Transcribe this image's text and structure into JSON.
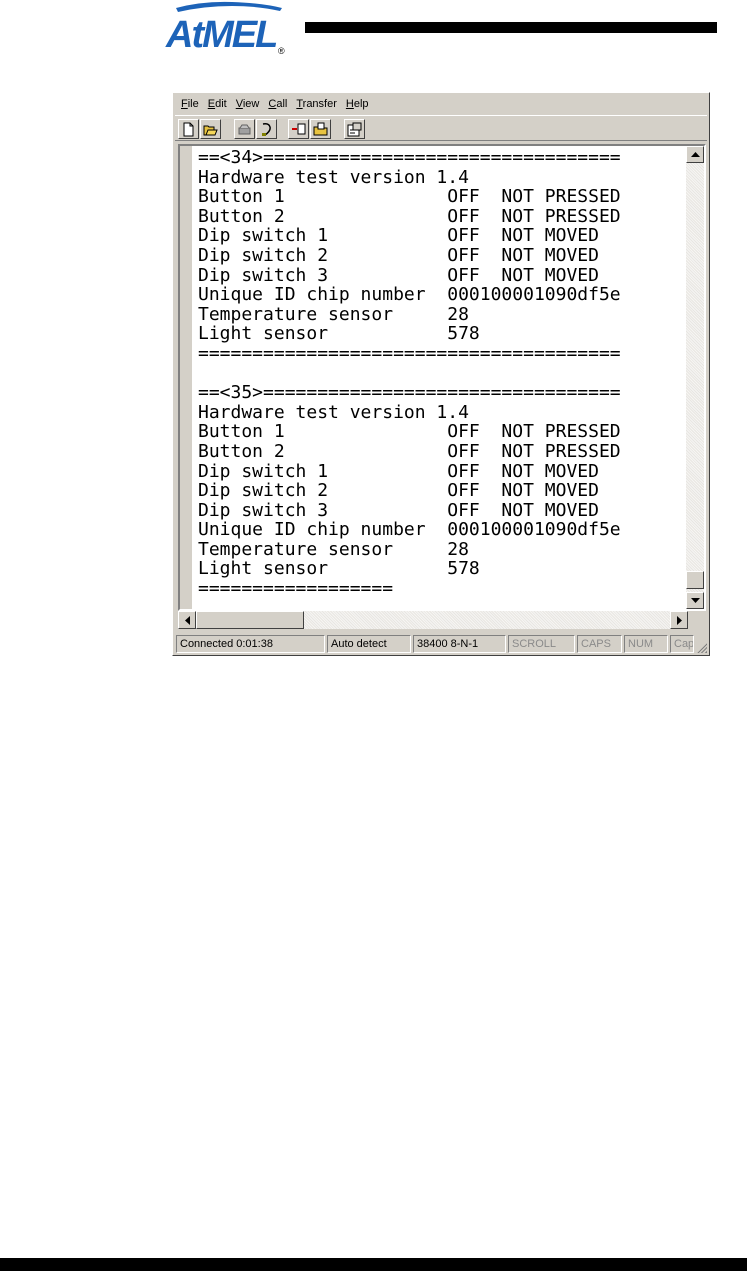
{
  "logo": {
    "text": "AtMEL",
    "mark": "®",
    "color": "#1d63b8"
  },
  "menu": [
    {
      "accel": "F",
      "rest": "ile"
    },
    {
      "accel": "E",
      "rest": "dit"
    },
    {
      "accel": "V",
      "rest": "iew"
    },
    {
      "accel": "C",
      "rest": "all"
    },
    {
      "accel": "T",
      "rest": "ransfer"
    },
    {
      "accel": "H",
      "rest": "elp"
    }
  ],
  "toolbar_icons": [
    "new-icon",
    "open-icon",
    "disconnect-icon",
    "connect-icon",
    "send-icon",
    "receive-icon",
    "properties-icon"
  ],
  "terminal": {
    "lines": [
      "==<34>=================================",
      "Hardware test version 1.4",
      "Button 1               OFF  NOT PRESSED",
      "Button 2               OFF  NOT PRESSED",
      "Dip switch 1           OFF  NOT MOVED",
      "Dip switch 2           OFF  NOT MOVED",
      "Dip switch 3           OFF  NOT MOVED",
      "Unique ID chip number  000100001090df5e",
      "Temperature sensor     28",
      "Light sensor           578",
      "=======================================",
      "",
      "==<35>=================================",
      "Hardware test version 1.4",
      "Button 1               OFF  NOT PRESSED",
      "Button 2               OFF  NOT PRESSED",
      "Dip switch 1           OFF  NOT MOVED",
      "Dip switch 2           OFF  NOT MOVED",
      "Dip switch 3           OFF  NOT MOVED",
      "Unique ID chip number  000100001090df5e",
      "Temperature sensor     28",
      "Light sensor           578",
      "=================="
    ]
  },
  "status": {
    "connection": "Connected 0:01:38",
    "detect": "Auto detect",
    "settings": "38400 8-N-1",
    "scroll": "SCROLL",
    "caps": "CAPS",
    "num": "NUM",
    "capture": "Cap"
  }
}
